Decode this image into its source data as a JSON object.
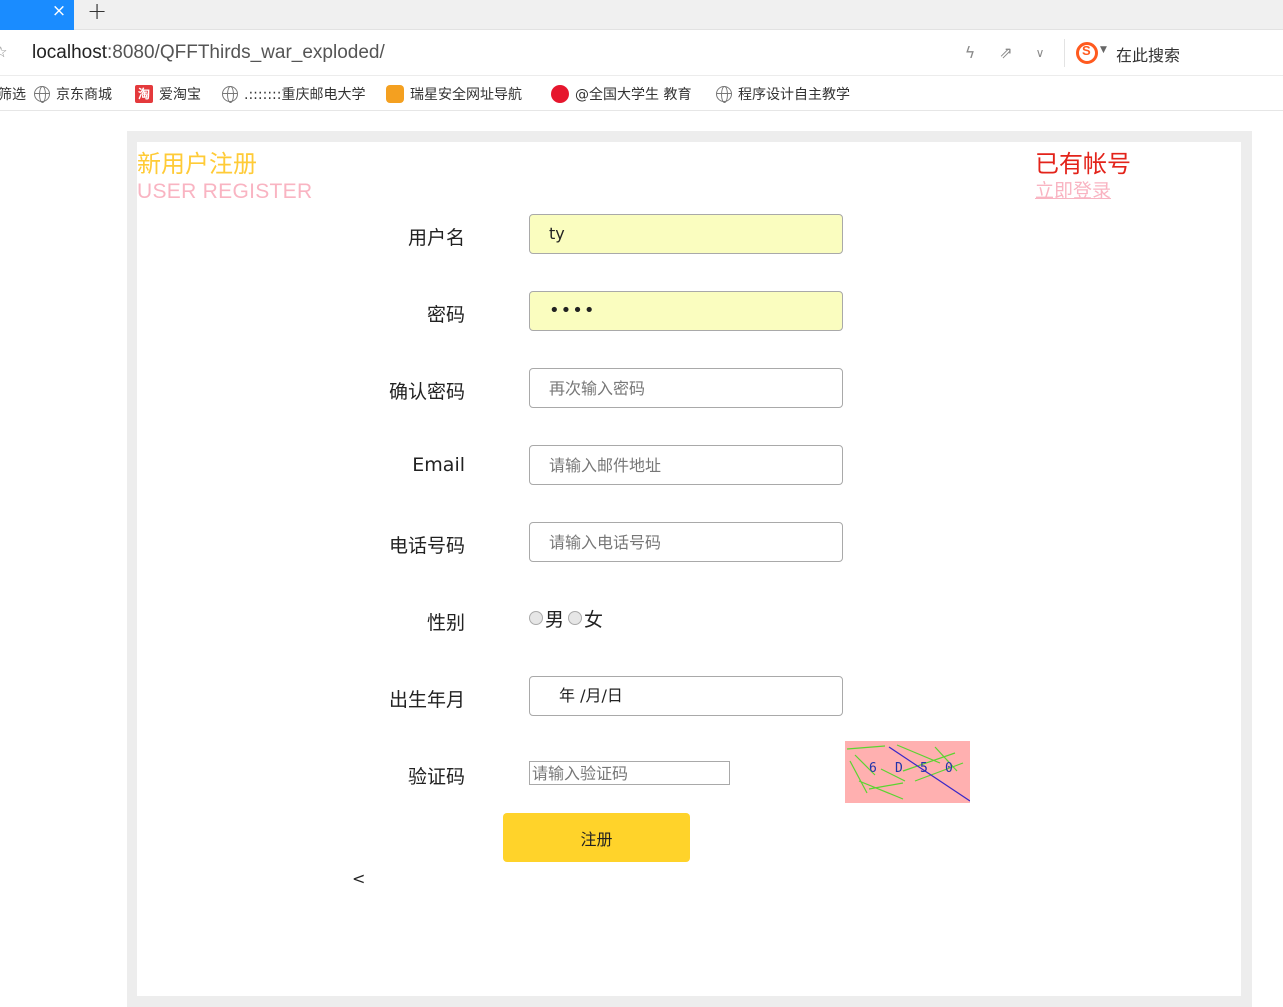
{
  "browser": {
    "tab_close_icon": "close-icon",
    "new_tab_icon": "plus-icon",
    "url_host": "localhost",
    "url_rest": ":8080/QFFThirds_war_exploded/",
    "search_engine_label": "在此搜索",
    "bookmarks": [
      {
        "label": "筛选",
        "icon": "none"
      },
      {
        "label": "京东商城",
        "icon": "globe-icon"
      },
      {
        "label": "爱淘宝",
        "icon": "taobao-icon"
      },
      {
        "label": ".:::::::重庆邮电大学",
        "icon": "globe-icon"
      },
      {
        "label": "瑞星安全网址导航",
        "icon": "tiger-icon"
      },
      {
        "label": "@全国大学生 教育",
        "icon": "weibo-icon"
      },
      {
        "label": "程序设计自主教学",
        "icon": "globe-icon"
      }
    ]
  },
  "header": {
    "title_cn": "新用户注册",
    "title_en": "USER REGISTER",
    "have_account": "已有帐号",
    "login_link": "立即登录"
  },
  "form": {
    "username_label": "用户名",
    "username_value": "ty",
    "password_label": "密码",
    "password_value": "••••",
    "confirm_label": "确认密码",
    "confirm_placeholder": "再次输入密码",
    "email_label": "Email",
    "email_placeholder": "请输入邮件地址",
    "phone_label": "电话号码",
    "phone_placeholder": "请输入电话号码",
    "gender_label": "性别",
    "gender_male": "男",
    "gender_female": "女",
    "birth_label": "出生年月",
    "birth_value": "年 /月/日",
    "captcha_label": "验证码",
    "captcha_placeholder": "请输入验证码",
    "captcha_text": [
      "6",
      "D",
      "5",
      "0"
    ],
    "submit_label": "注册",
    "stray_text": "<"
  },
  "colors": {
    "title_yellow": "#ffcb37",
    "title_pink": "#f9b4c2",
    "account_red": "#e3231a",
    "button_yellow": "#ffd32a",
    "autofill_bg": "#fafdbf",
    "captcha_bg": "#ffb0b0"
  }
}
